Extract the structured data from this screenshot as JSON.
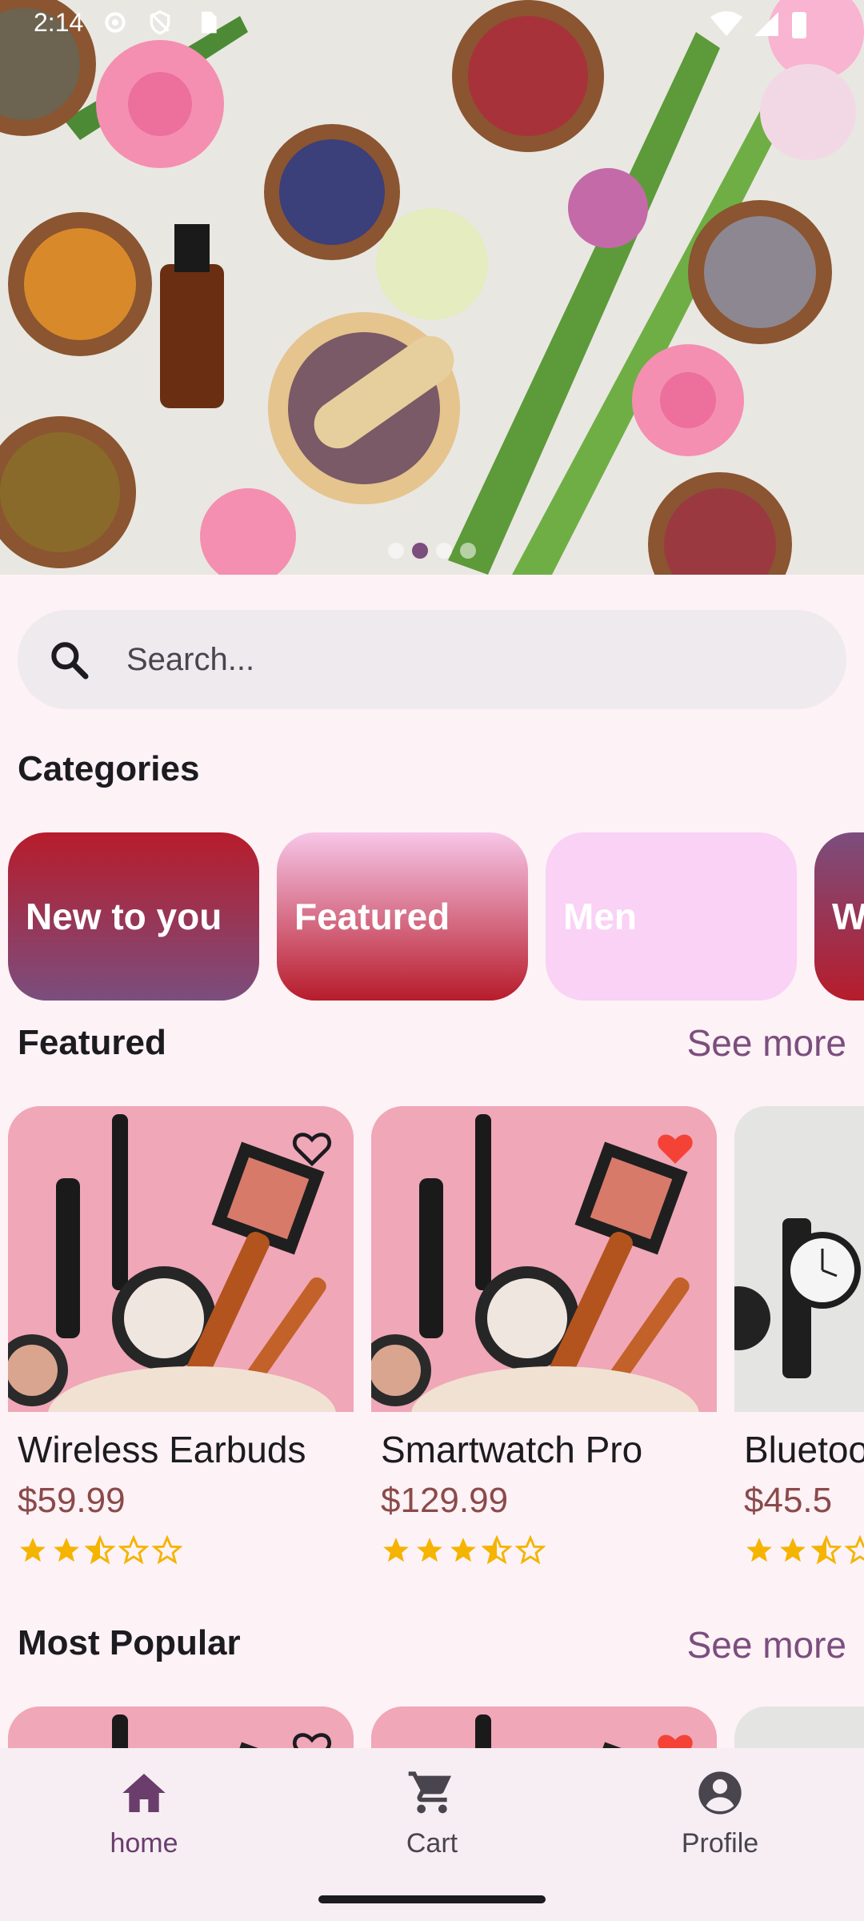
{
  "status_bar": {
    "time": "2:14"
  },
  "hero": {
    "slide_count": 4,
    "active_slide": 1
  },
  "search": {
    "placeholder": "Search..."
  },
  "categories": {
    "title": "Categories",
    "items": [
      {
        "label": "New to you"
      },
      {
        "label": "Featured"
      },
      {
        "label": "Men"
      },
      {
        "label": "Women"
      }
    ]
  },
  "featured": {
    "title": "Featured",
    "see_more": "See more",
    "products": [
      {
        "name": "Wireless Earbuds",
        "price": "$59.99",
        "rating": 2.5,
        "favorite": false
      },
      {
        "name": "Smartwatch Pro",
        "price": "$129.99",
        "rating": 3.5,
        "favorite": true
      },
      {
        "name": "Bluetooth Speaker",
        "price": "$45.5",
        "rating": 2.5,
        "favorite": false
      }
    ]
  },
  "most_popular": {
    "title": "Most Popular",
    "see_more": "See more",
    "products": [
      {
        "favorite": false
      },
      {
        "favorite": true
      },
      {
        "favorite": false
      }
    ]
  },
  "bottom_nav": {
    "items": [
      {
        "label": "home",
        "icon": "home-icon",
        "active": true
      },
      {
        "label": "Cart",
        "icon": "cart-icon",
        "active": false
      },
      {
        "label": "Profile",
        "icon": "profile-icon",
        "active": false
      }
    ]
  },
  "colors": {
    "accent": "#7b4e7e",
    "background": "#fdf2f6",
    "price": "#8b4a4a",
    "star": "#f4b400",
    "favorite": "#f44336"
  }
}
